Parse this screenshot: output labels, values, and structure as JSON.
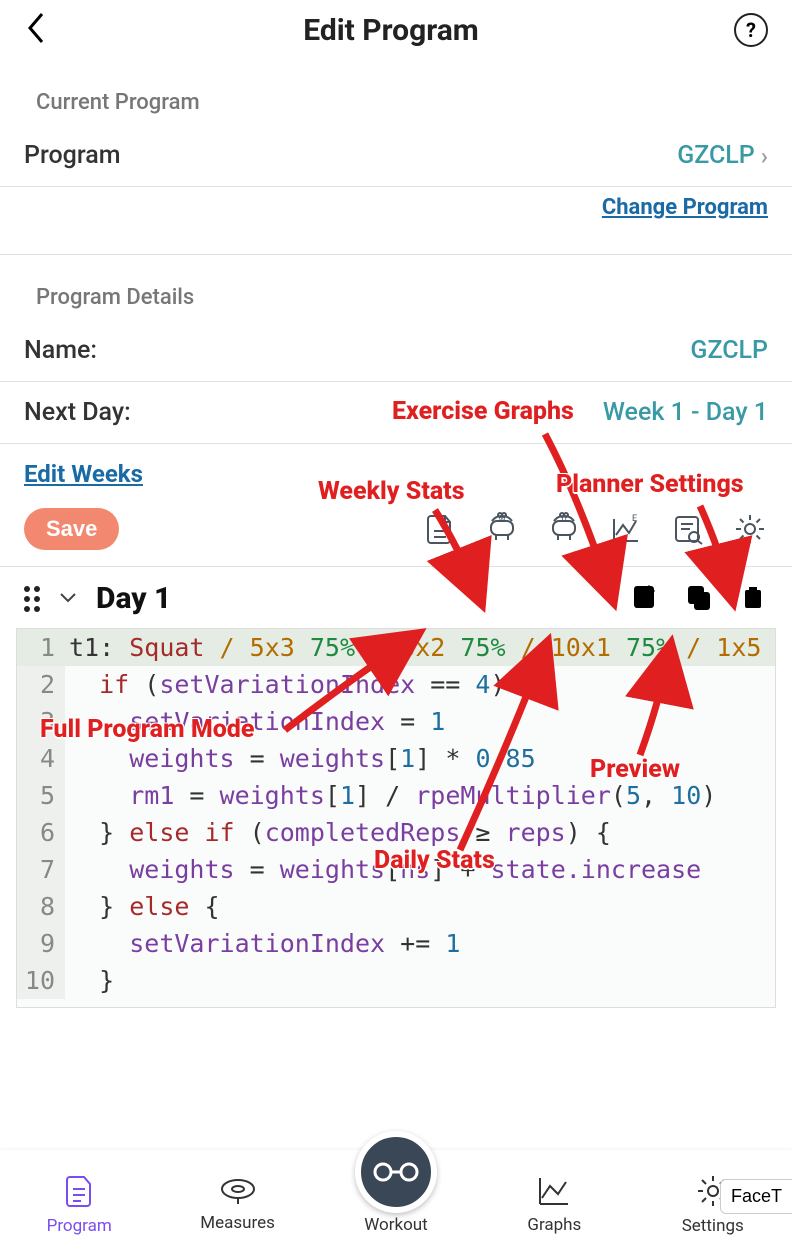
{
  "header": {
    "title": "Edit Program",
    "help": "?"
  },
  "currentProgram": {
    "section_label": "Current Program",
    "row_label": "Program",
    "value": "GZCLP",
    "change_link": "Change Program"
  },
  "details": {
    "section_label": "Program Details",
    "name": {
      "label": "Name:",
      "value": "GZCLP"
    },
    "next_day": {
      "label": "Next Day:",
      "value": "Week 1 - Day 1"
    },
    "edit_weeks": "Edit Weeks",
    "save": "Save"
  },
  "day": {
    "title": "Day 1"
  },
  "code": {
    "lines": [
      [
        {
          "t": "t1",
          "c": "sym"
        },
        {
          "t": ": ",
          "c": "sym"
        },
        {
          "t": "Squat",
          "c": "key"
        },
        {
          "t": " / ",
          "c": "slash"
        },
        {
          "t": "5x3 ",
          "c": "nm"
        },
        {
          "t": "75%",
          "c": "pc"
        },
        {
          "t": " / ",
          "c": "slash"
        },
        {
          "t": "6x2 ",
          "c": "nm"
        },
        {
          "t": "75%",
          "c": "pc"
        },
        {
          "t": " / ",
          "c": "slash"
        },
        {
          "t": "10x1 ",
          "c": "nm"
        },
        {
          "t": "75%",
          "c": "pc"
        },
        {
          "t": " / ",
          "c": "slash"
        },
        {
          "t": "1x5 ",
          "c": "nm"
        },
        {
          "t": "(",
          "c": "sym"
        }
      ],
      [
        {
          "t": "  if ",
          "c": "key"
        },
        {
          "t": "(",
          "c": "sym"
        },
        {
          "t": "setVariationIndex",
          "c": "id"
        },
        {
          "t": " == ",
          "c": "sym"
        },
        {
          "t": "4",
          "c": "num"
        },
        {
          "t": ") {",
          "c": "sym"
        }
      ],
      [
        {
          "t": "    ",
          "c": "sym"
        },
        {
          "t": "setVariationIndex",
          "c": "id"
        },
        {
          "t": " = ",
          "c": "sym"
        },
        {
          "t": "1",
          "c": "num"
        }
      ],
      [
        {
          "t": "    ",
          "c": "sym"
        },
        {
          "t": "weights",
          "c": "id"
        },
        {
          "t": " = ",
          "c": "sym"
        },
        {
          "t": "weights",
          "c": "id"
        },
        {
          "t": "[",
          "c": "sym"
        },
        {
          "t": "1",
          "c": "num"
        },
        {
          "t": "] * ",
          "c": "sym"
        },
        {
          "t": "0.85",
          "c": "num"
        }
      ],
      [
        {
          "t": "    ",
          "c": "sym"
        },
        {
          "t": "rm1",
          "c": "id"
        },
        {
          "t": " = ",
          "c": "sym"
        },
        {
          "t": "weights",
          "c": "id"
        },
        {
          "t": "[",
          "c": "sym"
        },
        {
          "t": "1",
          "c": "num"
        },
        {
          "t": "] / ",
          "c": "sym"
        },
        {
          "t": "rpeMultiplier",
          "c": "func"
        },
        {
          "t": "(",
          "c": "sym"
        },
        {
          "t": "5",
          "c": "num"
        },
        {
          "t": ", ",
          "c": "sym"
        },
        {
          "t": "10",
          "c": "num"
        },
        {
          "t": ")",
          "c": "sym"
        }
      ],
      [
        {
          "t": "  } ",
          "c": "sym"
        },
        {
          "t": "else if ",
          "c": "key"
        },
        {
          "t": "(",
          "c": "sym"
        },
        {
          "t": "completedReps",
          "c": "id"
        },
        {
          "t": " ≥ ",
          "c": "sym"
        },
        {
          "t": "reps",
          "c": "id"
        },
        {
          "t": ") {",
          "c": "sym"
        }
      ],
      [
        {
          "t": "    ",
          "c": "sym"
        },
        {
          "t": "weights",
          "c": "id"
        },
        {
          "t": " = ",
          "c": "sym"
        },
        {
          "t": "weights",
          "c": "id"
        },
        {
          "t": "[",
          "c": "sym"
        },
        {
          "t": "ns",
          "c": "id"
        },
        {
          "t": "] + ",
          "c": "sym"
        },
        {
          "t": "state.increase",
          "c": "id"
        }
      ],
      [
        {
          "t": "  } ",
          "c": "sym"
        },
        {
          "t": "else ",
          "c": "key"
        },
        {
          "t": "{",
          "c": "sym"
        }
      ],
      [
        {
          "t": "    ",
          "c": "sym"
        },
        {
          "t": "setVariationIndex",
          "c": "id"
        },
        {
          "t": " += ",
          "c": "sym"
        },
        {
          "t": "1",
          "c": "num"
        }
      ],
      [
        {
          "t": "  }",
          "c": "sym"
        }
      ]
    ]
  },
  "nav": {
    "items": [
      {
        "label": "Program"
      },
      {
        "label": "Measures"
      },
      {
        "label": "Workout"
      },
      {
        "label": "Graphs"
      },
      {
        "label": "Settings"
      }
    ],
    "chip": "FaceT"
  },
  "annotations": {
    "a": "Exercise Graphs",
    "b": "Weekly Stats",
    "c": "Planner Settings",
    "d": "Full Program Mode",
    "e": "Daily Stats",
    "f": "Preview"
  }
}
